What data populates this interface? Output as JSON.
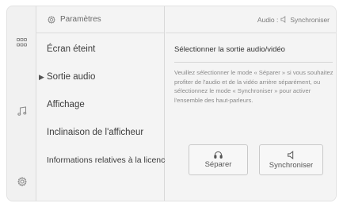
{
  "header": {
    "settings_title": "Paramètres",
    "audio_status_prefix": "Audio :",
    "audio_status_mode": "Synchroniser"
  },
  "rail": {
    "icons": [
      "apps-grid-icon",
      "music-note-icon",
      "gear-icon"
    ]
  },
  "menu": {
    "items": [
      {
        "label": "Écran éteint",
        "selected": false
      },
      {
        "label": "Sortie audio",
        "selected": true
      },
      {
        "label": "Affichage",
        "selected": false
      },
      {
        "label": "Inclinaison de l'afficheur",
        "selected": false
      },
      {
        "label": "Informations relatives à la licence",
        "selected": false
      }
    ]
  },
  "panel": {
    "title": "Sélectionner la sortie audio/vidéo",
    "description": "Veuillez sélectionner le mode « Séparer » si vous souhaitez profiter de l'audio et de la vidéo arrière séparément, ou sélectionnez le mode « Synchroniser » pour activer l'ensemble des haut-parleurs.",
    "buttons": {
      "separate_label": "Séparer",
      "separate_icon": "headphones-icon",
      "sync_label": "Synchroniser",
      "sync_icon": "speaker-icon"
    }
  }
}
